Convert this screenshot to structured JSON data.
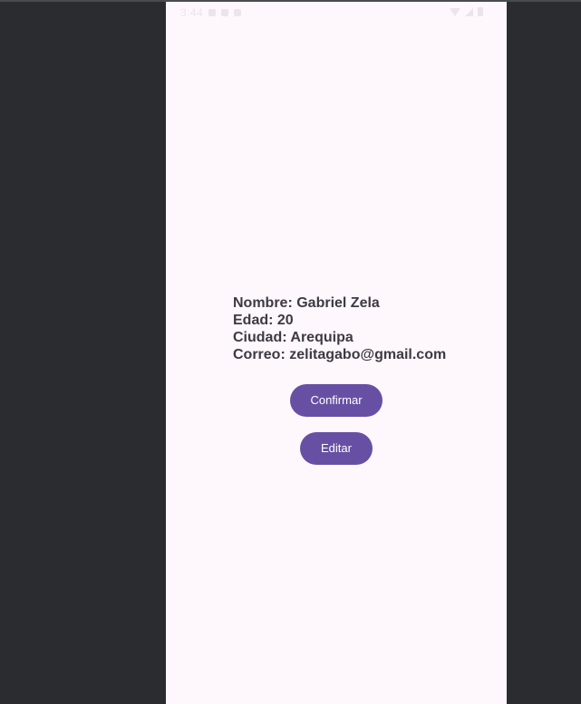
{
  "status_bar": {
    "time": "3:44"
  },
  "profile": {
    "nombre": "Nombre: Gabriel Zela",
    "edad": "Edad: 20",
    "ciudad": "Ciudad: Arequipa",
    "correo": "Correo: zelitagabo@gmail.com"
  },
  "buttons": {
    "confirm_label": "Confirmar",
    "edit_label": "Editar"
  },
  "colors": {
    "background": "#2b2c30",
    "screen": "#fef7fc",
    "text": "#3e3a42",
    "accent": "#6750a4"
  }
}
